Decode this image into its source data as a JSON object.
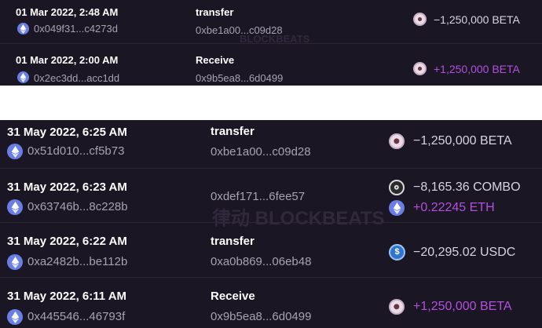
{
  "top_panel": {
    "rows": [
      {
        "time": "01 Mar 2022, 2:48 AM",
        "from": "0x049f31...c4273d",
        "method": "transfer",
        "hash": "0xbe1a00...c09d28",
        "amounts": [
          {
            "token": "BETA",
            "icon": "beta-token-icon",
            "text": "−1,250,000 BETA",
            "sign": "negative"
          }
        ]
      },
      {
        "time": "01 Mar 2022, 2:00 AM",
        "from": "0x2ec3dd...acc1dd",
        "method": "Receive",
        "hash": "0x9b5ea8...6d0499",
        "amounts": [
          {
            "token": "BETA",
            "icon": "beta-token-icon",
            "text": "+1,250,000 BETA",
            "sign": "positive"
          }
        ]
      }
    ],
    "watermark": "BLOCKBEATS"
  },
  "bottom_panel": {
    "rows": [
      {
        "time": "31 May 2022, 6:25 AM",
        "from": "0x51d010...cf5b73",
        "method": "transfer",
        "hash": "0xbe1a00...c09d28",
        "amounts": [
          {
            "token": "BETA",
            "icon": "beta-token-icon",
            "text": "−1,250,000 BETA",
            "sign": "negative"
          }
        ]
      },
      {
        "time": "31 May 2022, 6:23 AM",
        "from": "0x63746b...8c228b",
        "method": "",
        "hash": "0xdef171...6fee57",
        "amounts": [
          {
            "token": "COMBO",
            "icon": "combo-token-icon",
            "text": "−8,165.36 COMBO",
            "sign": "negative"
          },
          {
            "token": "ETH",
            "icon": "eth-token-icon",
            "text": "+0.22245 ETH",
            "sign": "positive"
          }
        ]
      },
      {
        "time": "31 May 2022, 6:22 AM",
        "from": "0xa2482b...be112b",
        "method": "transfer",
        "hash": "0xa0b869...06eb48",
        "amounts": [
          {
            "token": "USDC",
            "icon": "usdc-token-icon",
            "text": "−20,295.02 USDC",
            "sign": "negative"
          }
        ]
      },
      {
        "time": "31 May 2022, 6:11 AM",
        "from": "0x445546...46793f",
        "method": "Receive",
        "hash": "0x9b5ea8...6d0499",
        "amounts": [
          {
            "token": "BETA",
            "icon": "beta-token-icon",
            "text": "+1,250,000 BETA",
            "sign": "positive"
          }
        ]
      }
    ],
    "watermark": "律动 BLOCKBEATS"
  },
  "colors": {
    "background": "#1b1624",
    "divider": "#2c2638",
    "positive": "#b34fe0",
    "negative": "#d7d3df",
    "address": "#a7a2b2",
    "eth_badge": "#6a7fe6"
  }
}
